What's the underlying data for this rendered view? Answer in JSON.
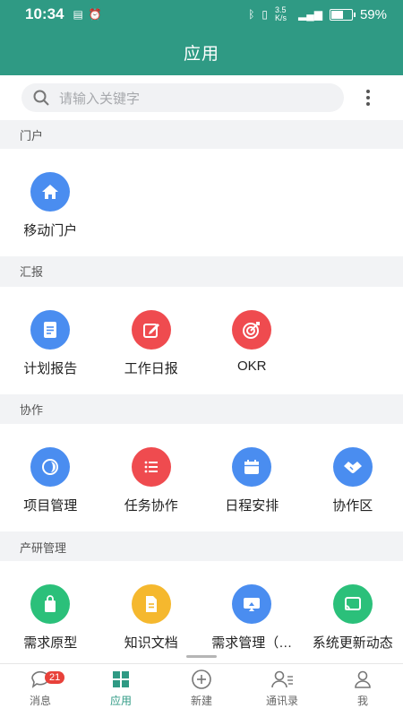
{
  "status": {
    "time": "10:34",
    "net_speed": "3.5 K/s",
    "battery_text": "59%",
    "battery_level": 0.59
  },
  "header": {
    "title": "应用"
  },
  "search": {
    "placeholder": "请输入关键字",
    "search_icon": "search-icon",
    "more_icon": "more-vertical-icon"
  },
  "sections": [
    {
      "title": "门户",
      "apps": [
        {
          "label": "移动门户",
          "icon": "home-icon",
          "color": "#4a8df0"
        }
      ]
    },
    {
      "title": "汇报",
      "apps": [
        {
          "label": "计划报告",
          "icon": "document-icon",
          "color": "#4a8df0"
        },
        {
          "label": "工作日报",
          "icon": "edit-icon",
          "color": "#ef4b4f"
        },
        {
          "label": "OKR",
          "icon": "target-icon",
          "color": "#ef4b4f"
        }
      ]
    },
    {
      "title": "协作",
      "apps": [
        {
          "label": "项目管理",
          "icon": "project-icon",
          "color": "#4a8df0"
        },
        {
          "label": "任务协作",
          "icon": "list-icon",
          "color": "#ef4b4f"
        },
        {
          "label": "日程安排",
          "icon": "calendar-icon",
          "color": "#4a8df0"
        },
        {
          "label": "协作区",
          "icon": "handshake-icon",
          "color": "#4a8df0"
        }
      ]
    },
    {
      "title": "产研管理",
      "apps": [
        {
          "label": "需求原型",
          "icon": "bag-icon",
          "color": "#2bc07a"
        },
        {
          "label": "知识文档",
          "icon": "file-icon",
          "color": "#f5b82e"
        },
        {
          "label": "需求管理（…",
          "icon": "monitor-icon",
          "color": "#4a8df0"
        },
        {
          "label": "系统更新动态",
          "icon": "cast-icon",
          "color": "#2bc07a"
        }
      ]
    }
  ],
  "tabs": [
    {
      "label": "消息",
      "icon": "chat-icon",
      "badge": "21"
    },
    {
      "label": "应用",
      "icon": "grid-icon",
      "active": true
    },
    {
      "label": "新建",
      "icon": "add-circle-icon"
    },
    {
      "label": "通讯录",
      "icon": "contacts-icon"
    },
    {
      "label": "我",
      "icon": "person-icon"
    }
  ],
  "colors": {
    "brand": "#2f9a84",
    "blue": "#4a8df0",
    "red": "#ef4b4f",
    "green": "#2bc07a",
    "yellow": "#f5b82e"
  }
}
